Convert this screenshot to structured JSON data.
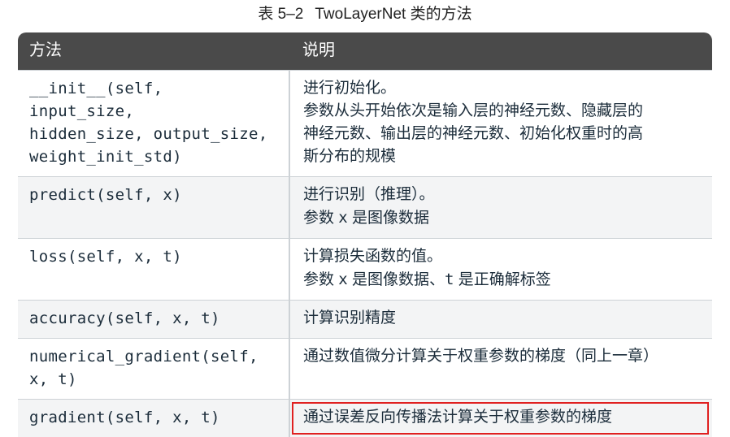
{
  "caption": {
    "number": "表 5–2",
    "title": "TwoLayerNet 类的方法"
  },
  "headers": {
    "method": "方法",
    "desc": "说明"
  },
  "rows": {
    "r0": {
      "method_l1": "__init__(self, input_size,",
      "method_l2": "hidden_size, output_size,",
      "method_l3": "weight_init_std)",
      "desc_l1": "进行初始化。",
      "desc_l2": "参数从头开始依次是输入层的神经元数、隐藏层的",
      "desc_l3": "神经元数、输出层的神经元数、初始化权重时的高",
      "desc_l4": "斯分布的规模"
    },
    "r1": {
      "method": "predict(self, x)",
      "desc_l1": "进行识别（推理）。",
      "desc_l2a": "参数 ",
      "desc_l2b": "x",
      "desc_l2c": " 是图像数据"
    },
    "r2": {
      "method": "loss(self, x, t)",
      "desc_l1": "计算损失函数的值。",
      "desc_l2a": "参数 ",
      "desc_l2b": "x",
      "desc_l2c": " 是图像数据、",
      "desc_l2d": "t",
      "desc_l2e": " 是正确解标签"
    },
    "r3": {
      "method": "accuracy(self, x, t)",
      "desc": "计算识别精度"
    },
    "r4": {
      "method": "numerical_gradient(self, x, t)",
      "desc": "通过数值微分计算关于权重参数的梯度（同上一章）"
    },
    "r5": {
      "method": "gradient(self, x, t)",
      "desc": "通过误差反向传播法计算关于权重参数的梯度"
    }
  }
}
